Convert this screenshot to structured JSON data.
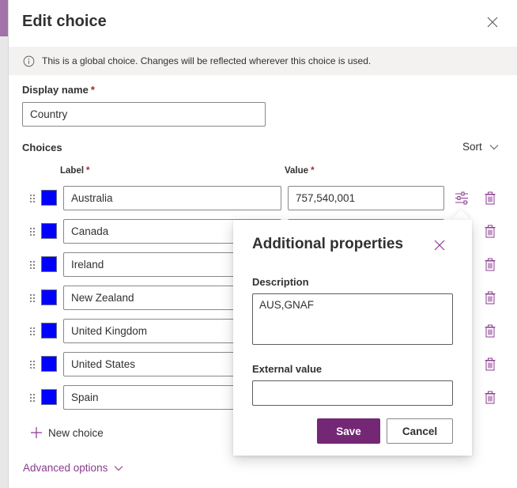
{
  "panel": {
    "title": "Edit choice",
    "close_icon": "close-icon",
    "info_message": "This is a global choice. Changes will be reflected wherever this choice is used.",
    "info_icon": "info-icon"
  },
  "display_name": {
    "label": "Display name",
    "required_marker": "*",
    "value": "Country"
  },
  "choices": {
    "heading": "Choices",
    "sort_label": "Sort",
    "label_column": "Label",
    "value_column": "Value",
    "required_marker": "*",
    "items": [
      {
        "label": "Australia",
        "value": "757,540,001",
        "color": "#0000ff"
      },
      {
        "label": "Canada",
        "value": "",
        "color": "#0000ff"
      },
      {
        "label": "Ireland",
        "value": "",
        "color": "#0000ff"
      },
      {
        "label": "New Zealand",
        "value": "",
        "color": "#0000ff"
      },
      {
        "label": "United Kingdom",
        "value": "",
        "color": "#0000ff"
      },
      {
        "label": "United States",
        "value": "",
        "color": "#0000ff"
      },
      {
        "label": "Spain",
        "value": "",
        "color": "#0000ff"
      }
    ],
    "new_choice_label": "New choice",
    "advanced_options_label": "Advanced options"
  },
  "callout": {
    "title": "Additional properties",
    "description_label": "Description",
    "description_value": "AUS,GNAF",
    "external_value_label": "External value",
    "external_value": "",
    "save_label": "Save",
    "cancel_label": "Cancel"
  },
  "colors": {
    "accent": "#742774",
    "link": "#8a3b8f",
    "swatch": "#0000ff",
    "required": "#a4262c"
  }
}
